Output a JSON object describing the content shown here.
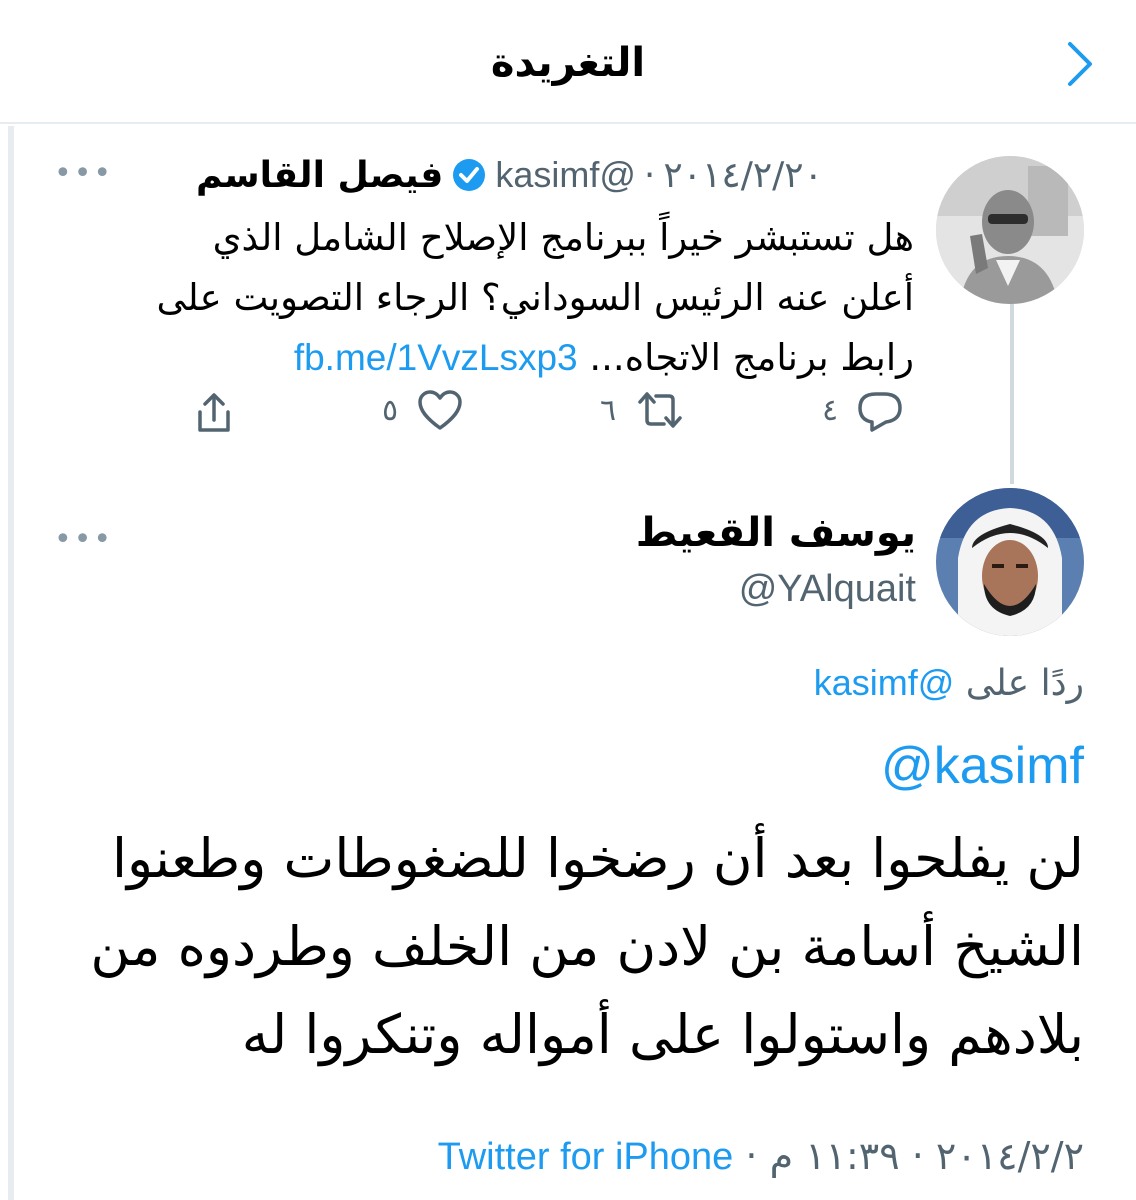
{
  "header": {
    "title": "التغريدة",
    "back_icon": "chevron-right-icon"
  },
  "tweet1": {
    "name": "فيصل القاسم",
    "verified": true,
    "handle": "@kasimf",
    "separator": "·",
    "date": "٢٠١٤/٢/٢٠",
    "text_lines": [
      "هل تستبشر خيراً ببرنامج الإصلاح الشامل الذي",
      "أعلن عنه الرئيس السوداني؟ الرجاء التصويت على",
      "رابط برنامج الاتجاه..."
    ],
    "link": "fb.me/1VvzLsxp3",
    "more_label": "•••",
    "actions": {
      "replies": "٤",
      "retweets": "٦",
      "likes": "٥"
    }
  },
  "tweet2": {
    "name": "يوسف القعيط",
    "handle": "@YAlquait",
    "more_label": "•••",
    "reply_to_label": "ردًا على",
    "reply_to_handle": "@kasimf",
    "mention": "@kasimf",
    "body_lines": [
      "لن يفلحوا بعد أن رضخوا للضغوطات وطعنوا",
      "الشيخ أسامة بن لادن من الخلف وطردوه من",
      "بلادهم واستولوا على أمواله وتنكروا له"
    ],
    "date": "٢٠١٤/٢/٢",
    "time": "١١:٣٩ م",
    "sep": "·",
    "source": "Twitter for iPhone"
  },
  "colors": {
    "accent": "#1d9bf0",
    "secondary_text": "#536471",
    "divider": "#e6ecf0"
  }
}
